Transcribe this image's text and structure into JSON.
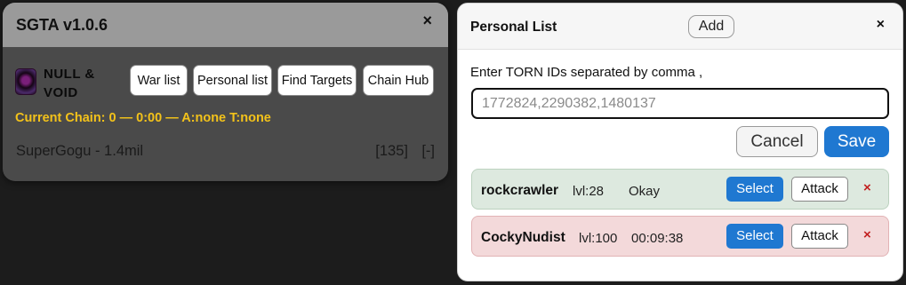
{
  "sgta": {
    "title": "SGTA v1.0.6",
    "close": "×",
    "faction_icon": "faction-emblem-icon",
    "faction_name": "NULL & VOID",
    "buttons": {
      "war_list": "War list",
      "personal_list": "Personal list",
      "find_targets": "Find Targets",
      "chain_hub": "Chain Hub"
    },
    "current_chain": "Current Chain: 0 — 0:00 — A:none T:none",
    "target": {
      "name": "SuperGogu - 1.4mil",
      "level": "[135]",
      "remove": "[-]"
    },
    "colors": {
      "chain_text": "#f3c21a"
    }
  },
  "personal_list": {
    "title": "Personal List",
    "add_label": "Add",
    "close": "×",
    "input_label": "Enter TORN IDs separated by comma ,",
    "input_placeholder": "1772824,2290382,1480137",
    "cancel_label": "Cancel",
    "save_label": "Save",
    "items": [
      {
        "name": "rockcrawler",
        "level": "lvl:28",
        "status": "Okay",
        "select": "Select",
        "attack": "Attack",
        "remove": "×"
      },
      {
        "name": "CockyNudist",
        "level": "lvl:100",
        "status": "00:09:38",
        "select": "Select",
        "attack": "Attack",
        "remove": "×"
      }
    ],
    "colors": {
      "primary": "#1f78d1",
      "ok_row": "#dde9df",
      "hospital_row": "#f3d9da",
      "remove": "#c21f1f"
    }
  }
}
